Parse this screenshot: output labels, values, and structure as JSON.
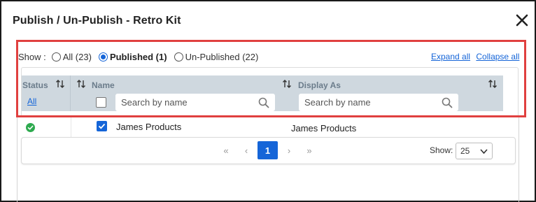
{
  "dialog": {
    "title": "Publish / Un-Publish - Retro Kit",
    "close_icon": "close-icon"
  },
  "filters": {
    "show_label": "Show :",
    "options": [
      {
        "label": "All (23)",
        "selected": false
      },
      {
        "label": "Published (1)",
        "selected": true
      },
      {
        "label": "Un-Published (22)",
        "selected": false
      }
    ]
  },
  "links": {
    "expand_all": "Expand all",
    "collapse_all": "Collapse all"
  },
  "table": {
    "columns": {
      "status": "Status",
      "status_filter": "All",
      "name": "Name",
      "display_as": "Display As"
    },
    "search": {
      "name_placeholder": "Search by name",
      "display_placeholder": "Search by name"
    },
    "rows": [
      {
        "status": "published",
        "checked": true,
        "name": "James Products",
        "display_as": "James Products"
      }
    ]
  },
  "pagination": {
    "first": "«",
    "prev": "‹",
    "current": "1",
    "next": "›",
    "last": "»",
    "show_label": "Show:",
    "page_size": "25"
  },
  "colors": {
    "accent": "#1565d8",
    "highlight": "#e0403f",
    "header_bg": "#cfd8df",
    "status_ok": "#2eaa4f"
  }
}
